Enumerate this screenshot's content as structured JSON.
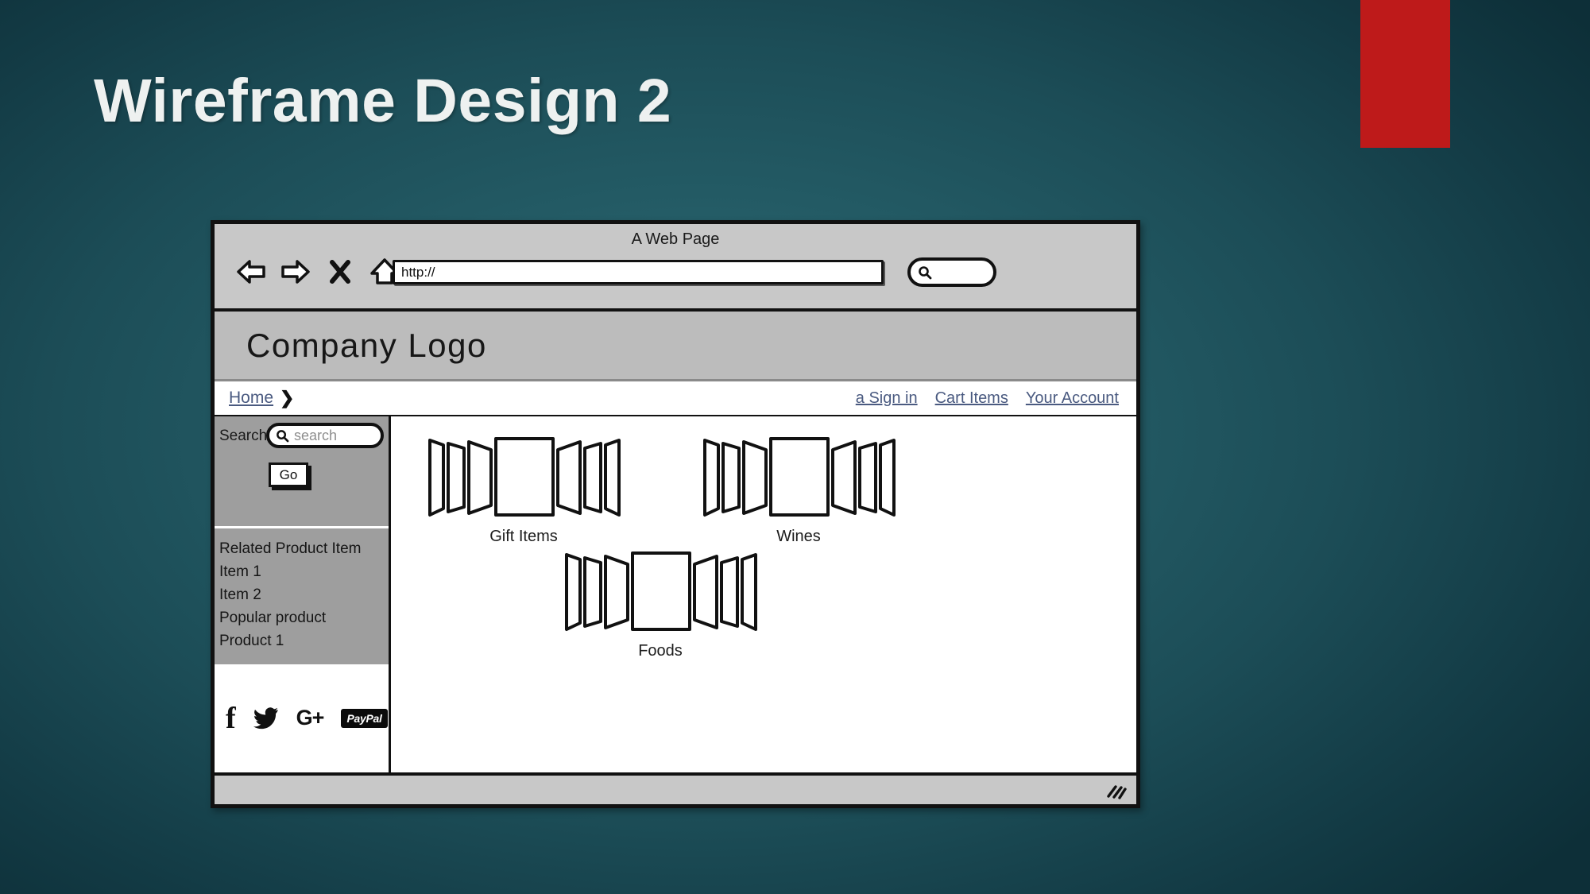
{
  "slide": {
    "title": "Wireframe Design 2",
    "accent_color": "#be1a1a",
    "background_color": "#1c4d57"
  },
  "browser": {
    "window_title": "A Web Page",
    "toolbar": {
      "back_icon": "back-arrow-icon",
      "forward_icon": "forward-arrow-icon",
      "stop_icon": "close-x-icon",
      "home_icon": "home-icon"
    },
    "url_bar": {
      "value": "http://",
      "placeholder": "http://"
    },
    "chrome_search": {
      "value": "",
      "placeholder": "",
      "icon": "search-icon"
    },
    "status_bar": {
      "resize_grip_icon": "resize-grip-icon"
    }
  },
  "page": {
    "logo": "Company Logo",
    "breadcrumb": {
      "home_label": "Home",
      "chevron": "❯"
    },
    "nav_links": [
      {
        "label": "a Sign in"
      },
      {
        "label": "Cart Items"
      },
      {
        "label": "Your Account"
      }
    ],
    "sidebar": {
      "search": {
        "label": "Search",
        "placeholder": "search",
        "value": "",
        "icon": "search-icon",
        "go_label": "Go"
      },
      "related": [
        {
          "label": "Related Product Item"
        },
        {
          "label": "Item 1"
        },
        {
          "label": "Item 2"
        },
        {
          "label": "Popular product"
        },
        {
          "label": "Product 1"
        }
      ],
      "social": [
        {
          "name": "facebook",
          "glyph": "f"
        },
        {
          "name": "twitter",
          "glyph": ""
        },
        {
          "name": "google-plus",
          "glyph": "G+"
        },
        {
          "name": "paypal",
          "glyph": "PayPal"
        }
      ]
    },
    "products": [
      {
        "label": "Gift Items"
      },
      {
        "label": "Wines"
      },
      {
        "label": "Foods"
      }
    ]
  }
}
